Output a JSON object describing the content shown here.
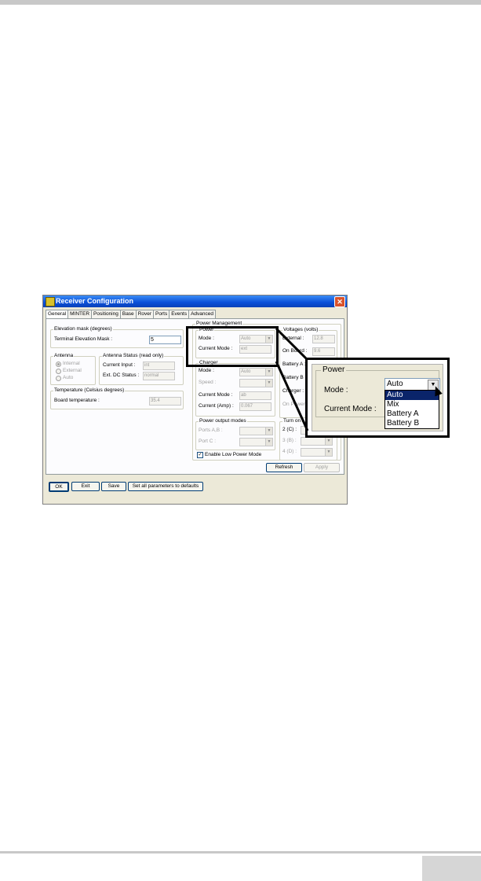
{
  "window": {
    "title": "Receiver Configuration",
    "close_glyph": "✕"
  },
  "tabs": [
    "General",
    "MINTER",
    "Positioning",
    "Base",
    "Rover",
    "Ports",
    "Events",
    "Advanced"
  ],
  "elevation": {
    "group_title": "Elevation mask (degrees)",
    "label": "Terminal Elevation Mask :",
    "value": "5"
  },
  "antenna": {
    "group_title": "Antenna",
    "options": [
      "Internal",
      "External",
      "Auto"
    ],
    "selected": "Internal"
  },
  "antenna_status": {
    "group_title": "Antenna Status (read only)",
    "current_input_label": "Current Input :",
    "current_input_value": "int",
    "ext_dc_label": "Ext. DC Status :",
    "ext_dc_value": "normal"
  },
  "temperature": {
    "group_title": "Temperature (Celsius degrees)",
    "label": "Board temperature :",
    "value": "35.4"
  },
  "power_management": {
    "group_title": "Power Management",
    "power": {
      "group_title": "Power",
      "mode_label": "Mode :",
      "mode_value": "Auto",
      "current_mode_label": "Current Mode :",
      "current_mode_value": "ext"
    },
    "charger": {
      "group_title": "Charger",
      "mode_label": "Mode :",
      "mode_value": "Auto",
      "speed_label": "Speed :",
      "current_mode_label": "Current Mode :",
      "current_mode_value": "ab",
      "current_amp_label": "Current (Amp) :",
      "current_amp_value": "0.067"
    },
    "output_modes": {
      "group_title": "Power output modes",
      "ports_ab_label": "Ports A,B :",
      "port_c_label": "Port C :"
    },
    "low_power_label": "Enable Low Power Mode",
    "low_power_checked": "✓"
  },
  "voltages": {
    "group_title": "Voltages (volts)",
    "external_label": "External :",
    "external_value": "12.8",
    "on_board_label": "On Board :",
    "on_board_value": "9.6",
    "battery_a_label": "Battery A :",
    "battery_b_label": "Battery B :",
    "charger_label": "Charger :",
    "on_power_label": "On Power :"
  },
  "turn_on": {
    "group_title": "Turn on",
    "row2": "2 (C) :",
    "row3": "3 (B) :",
    "row4": "4 (D) :"
  },
  "buttons": {
    "refresh": "Refresh",
    "apply": "Apply",
    "ok": "OK",
    "exit": "Exit",
    "save": "Save",
    "defaults": "Set all parameters to defaults"
  },
  "zoom": {
    "group_title": "Power",
    "mode_label": "Mode :",
    "mode_value": "Auto",
    "current_mode_label": "Current Mode :",
    "options": [
      "Auto",
      "Mix",
      "Battery A",
      "Battery B"
    ],
    "selected": "Auto"
  },
  "colors": {
    "titlebar": "#0a4fd8",
    "dialog_bg": "#ece9d8",
    "selection": "#0a246a"
  }
}
